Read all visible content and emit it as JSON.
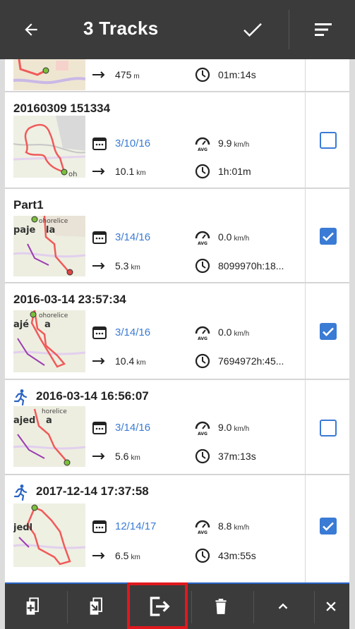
{
  "appbar": {
    "title": "3 Tracks",
    "back_icon": "arrow-back-icon",
    "confirm_icon": "checkmark-icon",
    "menu_icon": "sort-menu-icon"
  },
  "colors": {
    "appbar": "#3b3b3b",
    "accent": "#3a7bd5",
    "highlight": "#e0181e",
    "route": "#f05a5a"
  },
  "partial_row": {
    "distance_value": "475",
    "distance_unit": "m",
    "duration": "01m:14s"
  },
  "tracks": [
    {
      "name": "20160309 151334",
      "activity_icon": "",
      "date": "3/10/16",
      "avg_speed": "9.9",
      "speed_unit": "km/h",
      "distance_value": "10.1",
      "distance_unit": "km",
      "duration": "1h:01m",
      "checked": false
    },
    {
      "name": "Part1",
      "activity_icon": "",
      "date": "3/14/16",
      "avg_speed": "0.0",
      "speed_unit": "km/h",
      "distance_value": "5.3",
      "distance_unit": "km",
      "duration": "8099970h:18...",
      "checked": true
    },
    {
      "name": "2016-03-14 23:57:34",
      "activity_icon": "",
      "date": "3/14/16",
      "avg_speed": "0.0",
      "speed_unit": "km/h",
      "distance_value": "10.4",
      "distance_unit": "km",
      "duration": "7694972h:45...",
      "checked": true
    },
    {
      "name": "2016-03-14 16:56:07",
      "activity_icon": "running-icon",
      "date": "3/14/16",
      "avg_speed": "9.0",
      "speed_unit": "km/h",
      "distance_value": "5.6",
      "distance_unit": "km",
      "duration": "37m:13s",
      "checked": false
    },
    {
      "name": "2017-12-14 17:37:58",
      "activity_icon": "running-icon",
      "date": "12/14/17",
      "avg_speed": "8.8",
      "speed_unit": "km/h",
      "distance_value": "6.5",
      "distance_unit": "km",
      "duration": "43m:55s",
      "checked": true
    }
  ],
  "map_labels": {
    "thumb1": "oh",
    "thumb2_a": "paje",
    "thumb2_b": "la",
    "thumb2_c": "ohorelice",
    "thumb3_a": "ajé",
    "thumb3_b": "a",
    "thumb3_c": "ohorelice",
    "thumb4_a": "ajed",
    "thumb4_b": "a",
    "thumb4_c": "horelice",
    "thumb5_a": "jedl"
  },
  "bottom_toolbar": {
    "buttons": [
      "add-track-icon",
      "merge-track-icon",
      "export-icon",
      "delete-icon",
      "collapse-icon",
      "close-icon"
    ],
    "highlighted": "export-icon"
  }
}
